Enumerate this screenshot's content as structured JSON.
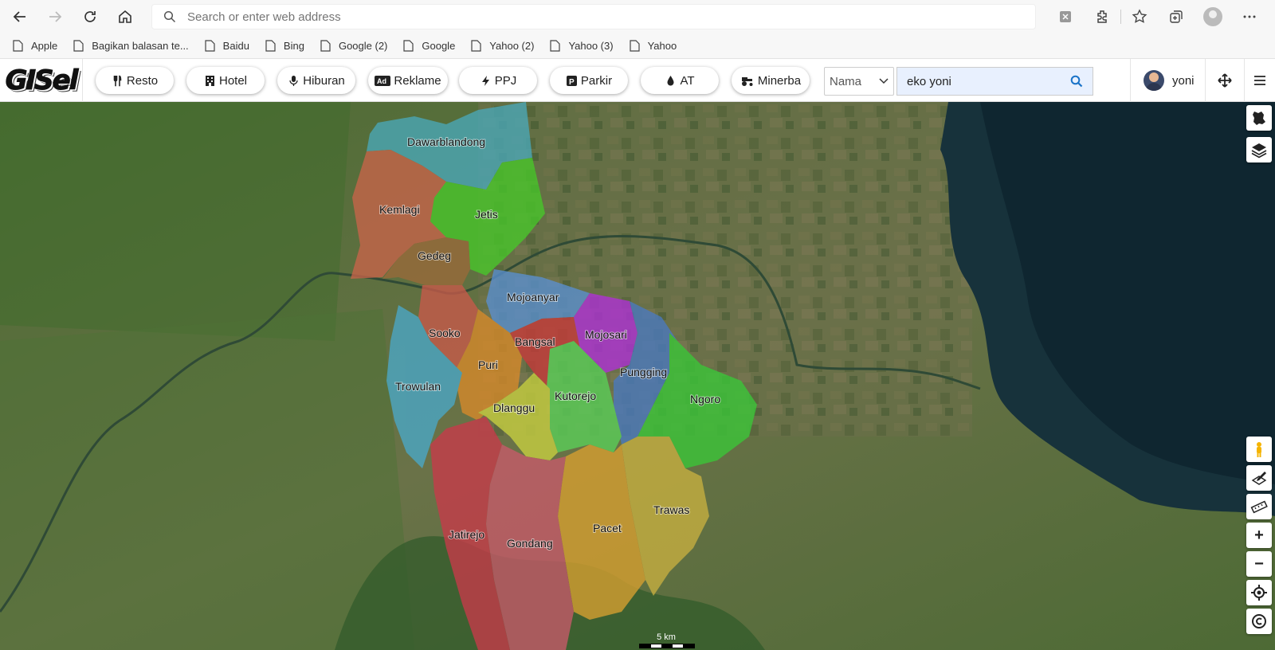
{
  "browser": {
    "address_placeholder": "Search or enter web address",
    "bookmarks": [
      "Apple",
      "Bagikan balasan te...",
      "Baidu",
      "Bing",
      "Google (2)",
      "Google",
      "Yahoo (2)",
      "Yahoo (3)",
      "Yahoo"
    ]
  },
  "app": {
    "logo": "GISel",
    "categories": [
      "Resto",
      "Hotel",
      "Hiburan",
      "Reklame",
      "PPJ",
      "Parkir",
      "AT",
      "Minerba"
    ],
    "search_field_select": "Nama",
    "search_value": "eko yoni",
    "user_name": "yoni"
  },
  "map": {
    "regions": [
      "Dawarblandong",
      "Kemlagi",
      "Jetis",
      "Gedeg",
      "Mojoanyar",
      "Sooko",
      "Bangsal",
      "Mojosari",
      "Puri",
      "Pungging",
      "Trowulan",
      "Kutorejo",
      "Ngoro",
      "Dlanggu",
      "Trawas",
      "Pacet",
      "Jatirejo",
      "Gondang"
    ],
    "scale_label": "5 km",
    "colors": {
      "Dawarblandong": "#4aa8b8",
      "Kemlagi": "#c8644a",
      "Jetis": "#48c82a",
      "Gedeg": "#9a6a3a",
      "Mojoanyar": "#5a90d0",
      "Sooko": "#c85a4a",
      "Bangsal": "#c83a3a",
      "Mojosari": "#b030d8",
      "Puri": "#d88a2a",
      "Pungging": "#4a7ac0",
      "Trowulan": "#4aa8c8",
      "Kutorejo": "#5ad058",
      "Ngoro": "#3ac838",
      "Dlanggu": "#c8d040",
      "Trawas": "#c8b040",
      "Pacet": "#d8a030",
      "Jatirejo": "#c83a4a",
      "Gondang": "#c85a6a"
    }
  }
}
